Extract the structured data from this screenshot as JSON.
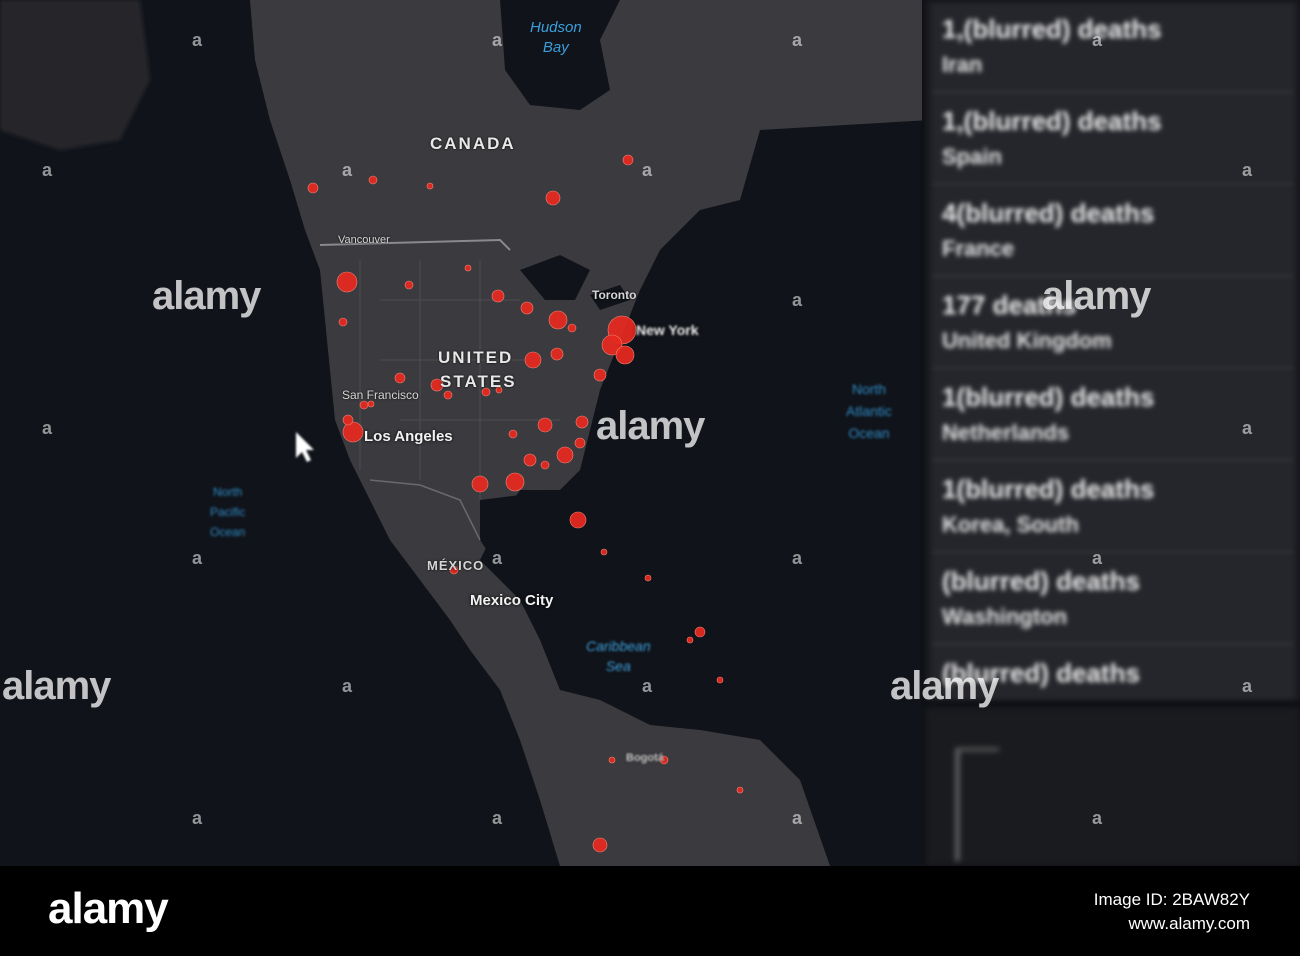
{
  "map": {
    "countries": {
      "canada": "CANADA",
      "united_states_1": "UNITED",
      "united_states_2": "STATES",
      "mexico": "MÉXICO"
    },
    "cities": {
      "hudson_bay_1": "Hudson",
      "hudson_bay_2": "Bay",
      "vancouver": "Vancouver",
      "toronto": "Toronto",
      "new_york": "New York",
      "san_francisco": "San Francisco",
      "los_angeles": "Los Angeles",
      "mexico_city": "Mexico City",
      "caribbean_1": "Caribbean",
      "caribbean_2": "Sea",
      "bogota": "Bogotá",
      "north_pacific_1": "North",
      "north_pacific_2": "Pacific",
      "north_pacific_3": "Ocean",
      "north_atlantic_1": "North",
      "north_atlantic_2": "Atlantic",
      "north_atlantic_3": "Ocean"
    },
    "colors": {
      "land": "#3b3b3f",
      "ocean": "#10131a",
      "border": "#6a6a6e",
      "hotspot": "#e8291f",
      "water_label": "#3c9fd9"
    }
  },
  "list_panel": {
    "items": [
      {
        "count": "1,(blurred) deaths",
        "name": "Iran"
      },
      {
        "count": "1,(blurred) deaths",
        "name": "Spain"
      },
      {
        "count": "4(blurred) deaths",
        "name": "France"
      },
      {
        "count": "177 deaths",
        "name": "United Kingdom"
      },
      {
        "count": "1(blurred) deaths",
        "name": "Netherlands"
      },
      {
        "count": "1(blurred) deaths",
        "name": "Korea, South"
      },
      {
        "count": "(blurred) deaths",
        "name": "Washington"
      },
      {
        "count": "(blurred) deaths",
        "name": ""
      }
    ]
  },
  "watermark": {
    "brand": "alamy",
    "image_id": "Image ID: 2BAW82Y",
    "site": "www.alamy.com",
    "letter": "a"
  }
}
